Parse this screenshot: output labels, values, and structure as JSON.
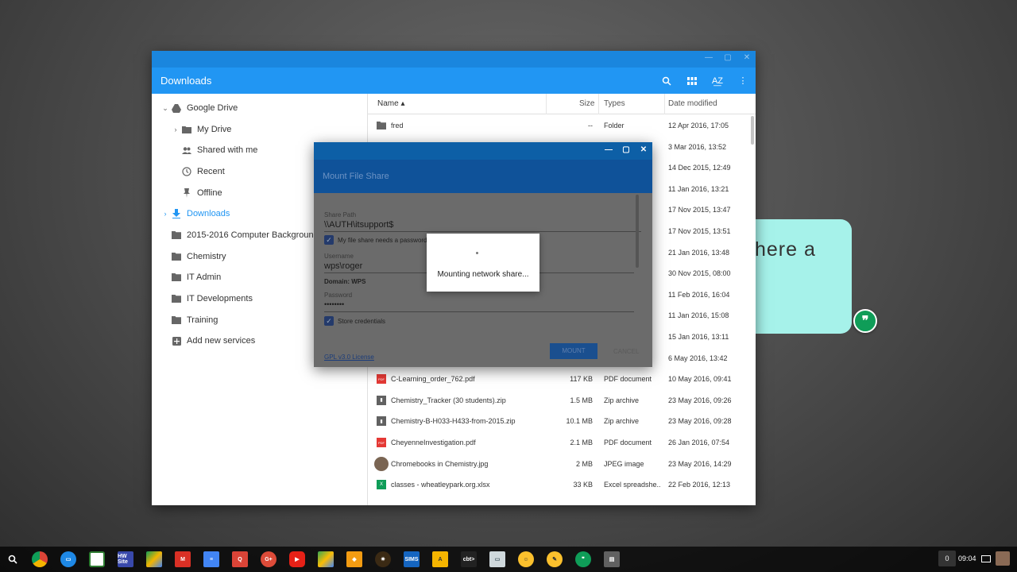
{
  "files_app": {
    "title": "Downloads",
    "columns": {
      "name": "Name ▴",
      "size": "Size",
      "types": "Types",
      "date": "Date modified"
    },
    "sidebar": [
      {
        "label": "Google Drive",
        "icon": "drive-icon",
        "chevron": "⌄"
      },
      {
        "label": "My Drive",
        "icon": "my-drive-icon",
        "chevron": "›"
      },
      {
        "label": "Shared with me",
        "icon": "shared-icon",
        "chevron": ""
      },
      {
        "label": "Recent",
        "icon": "clock-icon",
        "chevron": ""
      },
      {
        "label": "Offline",
        "icon": "pin-icon",
        "chevron": ""
      },
      {
        "label": "Downloads",
        "icon": "download-icon",
        "chevron": "›"
      },
      {
        "label": "2015-2016 Computer Backgrounds",
        "icon": "folder-icon",
        "chevron": ""
      },
      {
        "label": "Chemistry",
        "icon": "folder-icon",
        "chevron": ""
      },
      {
        "label": "IT Admin",
        "icon": "folder-icon",
        "chevron": ""
      },
      {
        "label": "IT Developments",
        "icon": "folder-icon",
        "chevron": ""
      },
      {
        "label": "Training",
        "icon": "folder-icon",
        "chevron": ""
      },
      {
        "label": "Add new services",
        "icon": "add-icon",
        "chevron": ""
      }
    ],
    "files": [
      {
        "name": "fred",
        "size": "--",
        "type": "Folder",
        "date": "12 Apr 2016, 17:05",
        "icon": "folder-icon"
      },
      {
        "name": "",
        "size": "",
        "type": "",
        "date": "3 Mar 2016, 13:52",
        "icon": ""
      },
      {
        "name": "",
        "size": "",
        "type": "",
        "date": "14 Dec 2015, 12:49",
        "icon": ""
      },
      {
        "name": "",
        "size": "",
        "type": "",
        "date": "11 Jan 2016, 13:21",
        "icon": ""
      },
      {
        "name": "",
        "size": "",
        "type": "",
        "date": "17 Nov 2015, 13:47",
        "icon": ""
      },
      {
        "name": "",
        "size": "",
        "type": "",
        "date": "17 Nov 2015, 13:51",
        "icon": ""
      },
      {
        "name": "",
        "size": "",
        "type": "",
        "date": "21 Jan 2016, 13:48",
        "icon": ""
      },
      {
        "name": "",
        "size": "",
        "type": "",
        "date": "30 Nov 2015, 08:00",
        "icon": ""
      },
      {
        "name": "",
        "size": "",
        "type": "",
        "date": "11 Feb 2016, 16:04",
        "icon": ""
      },
      {
        "name": "",
        "size": "",
        "type": "",
        "date": "11 Jan 2016, 15:08",
        "icon": ""
      },
      {
        "name": "",
        "size": "",
        "type": "",
        "date": "15 Jan 2016, 13:11",
        "icon": ""
      },
      {
        "name": "",
        "size": "",
        "type": "",
        "date": "6 May 2016, 13:42",
        "icon": ""
      },
      {
        "name": "C-Learning_order_762.pdf",
        "size": "117 KB",
        "type": "PDF document",
        "date": "10 May 2016, 09:41",
        "icon": "pdf-icon"
      },
      {
        "name": "Chemistry_Tracker (30 students).zip",
        "size": "1.5 MB",
        "type": "Zip archive",
        "date": "23 May 2016, 09:26",
        "icon": "zip-icon"
      },
      {
        "name": "Chemistry-B-H033-H433-from-2015.zip",
        "size": "10.1 MB",
        "type": "Zip archive",
        "date": "23 May 2016, 09:28",
        "icon": "zip-icon"
      },
      {
        "name": "CheyenneInvestigation.pdf",
        "size": "2.1 MB",
        "type": "PDF document",
        "date": "26 Jan 2016, 07:54",
        "icon": "pdf-icon"
      },
      {
        "name": "Chromebooks in Chemistry.jpg",
        "size": "2 MB",
        "type": "JPEG image",
        "date": "23 May 2016, 14:29",
        "icon": "image-thumb-icon"
      },
      {
        "name": "classes - wheatleypark.org.xlsx",
        "size": "33 KB",
        "type": "Excel spreadshe...",
        "date": "22 Feb 2016, 12:13",
        "icon": "excel-icon"
      }
    ]
  },
  "mount_dialog": {
    "title": "Mount File Share",
    "share_path_label": "Share Path",
    "share_path_value": "\\\\AUTH\\itsupport$",
    "needs_password_label": "My file share needs a password",
    "username_label": "Username",
    "username_value": "wps\\roger",
    "domain_text": "Domain: WPS",
    "password_label": "Password",
    "password_value": "••••••••",
    "store_credentials_label": "Store credentials",
    "license_link": "GPL v3.0 License",
    "mount_button": "MOUNT",
    "cancel_button": "CANCEL"
  },
  "progress": {
    "message": "Mounting network share..."
  },
  "background_bubble": {
    "text": "here a"
  },
  "shelf": {
    "apps": [
      "chrome-icon",
      "files-icon",
      "drawing-icon",
      "hw-site-icon",
      "google-drive-icon",
      "gmail-icon",
      "google-docs-icon",
      "quick-office-icon",
      "google-plus-icon",
      "youtube-icon",
      "google-maps-icon",
      "dropbox-icon",
      "puzzle-icon",
      "sims-icon",
      "audio-icon",
      "terminal-icon",
      "remote-desktop-icon",
      "account-icon",
      "keep-icon",
      "hangouts-icon",
      "screenshot-icon"
    ],
    "hw_site_label": "HW Site",
    "sims_label": "SIMS",
    "a_label": "A",
    "crosh_label": "cbt>",
    "notification_count": "0",
    "clock": "09:04"
  }
}
